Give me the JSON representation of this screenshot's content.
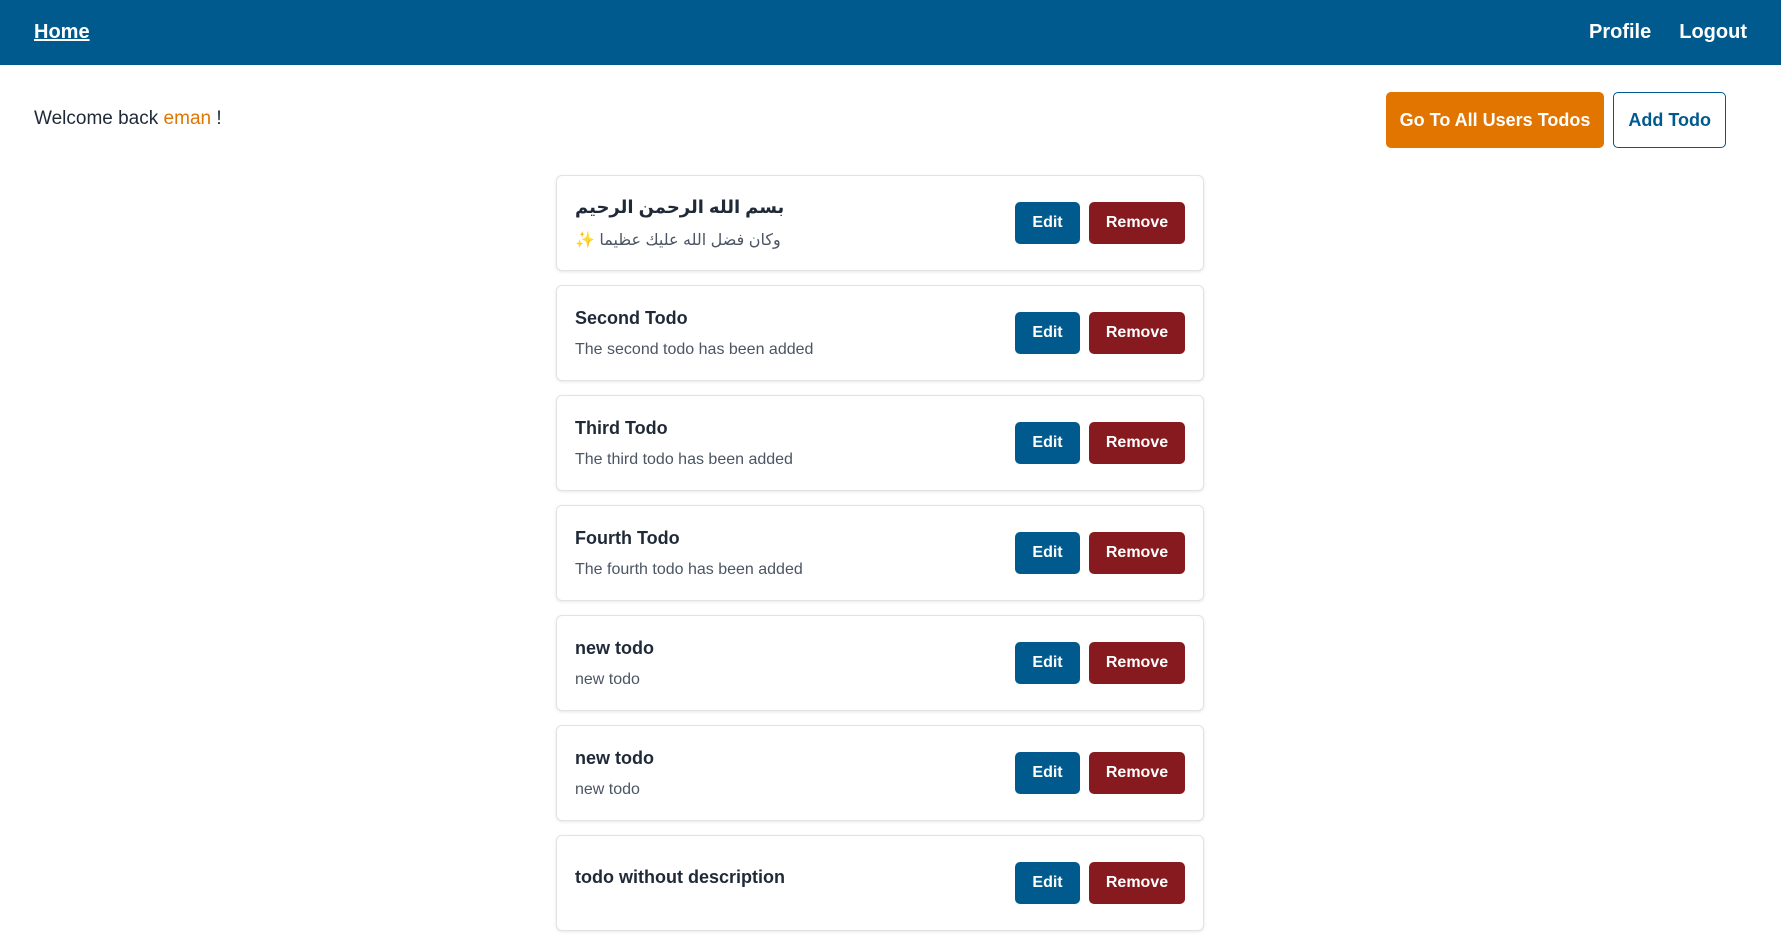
{
  "nav": {
    "home": "Home",
    "profile": "Profile",
    "logout": "Logout"
  },
  "welcome": {
    "prefix": "Welcome back",
    "username": "eman",
    "suffix": "!"
  },
  "actions": {
    "all_users_todos": "Go To All Users Todos",
    "add_todo": "Add Todo"
  },
  "todo_buttons": {
    "edit": "Edit",
    "remove": "Remove"
  },
  "todos": [
    {
      "title": "بسم الله الرحمن الرحيم",
      "description": "وكان فضل الله عليك عظيما ✨"
    },
    {
      "title": "Second Todo",
      "description": "The second todo has been added"
    },
    {
      "title": "Third Todo",
      "description": "The third todo has been added"
    },
    {
      "title": "Fourth Todo",
      "description": "The fourth todo has been added"
    },
    {
      "title": "new todo",
      "description": "new todo"
    },
    {
      "title": "new todo",
      "description": "new todo"
    },
    {
      "title": "todo without description",
      "description": ""
    }
  ],
  "colors": {
    "primary": "#005a8d",
    "accent": "#e27400",
    "danger": "#861a1e"
  }
}
